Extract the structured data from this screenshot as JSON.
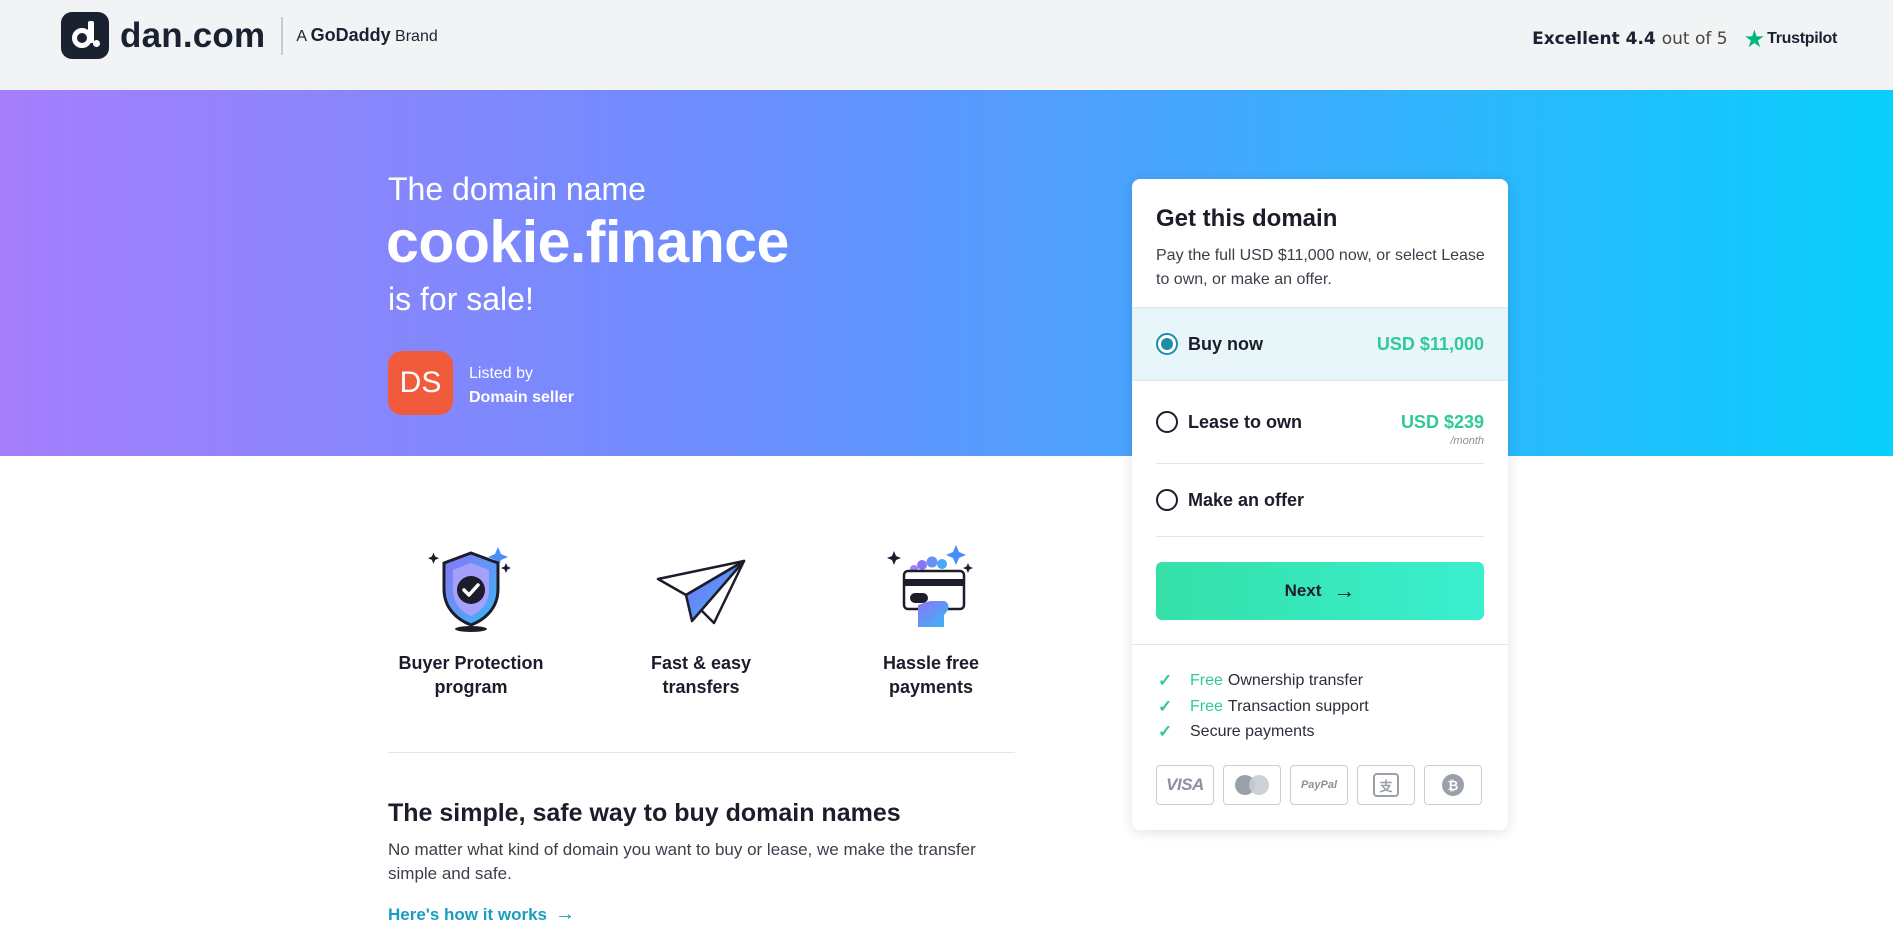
{
  "header": {
    "logo_text": "dan.com",
    "brand_prefix": "A",
    "brand_name": "GoDaddy",
    "brand_suffix": "Brand",
    "trust_rating_label": "Excellent 4.4",
    "trust_rating_scale": "out of 5",
    "trust_provider": "Trustpilot"
  },
  "hero": {
    "line1": "The domain name",
    "domain": "cookie.finance",
    "line2": "is for sale!",
    "avatar_initials": "DS",
    "listed_by_label": "Listed by",
    "seller_name": "Domain seller"
  },
  "features": [
    {
      "label_line1": "Buyer Protection",
      "label_line2": "program",
      "icon": "shield-check-icon"
    },
    {
      "label_line1": "Fast & easy",
      "label_line2": "transfers",
      "icon": "paper-plane-icon"
    },
    {
      "label_line1": "Hassle free",
      "label_line2": "payments",
      "icon": "card-payment-icon"
    }
  ],
  "info": {
    "title": "The simple, safe way to buy domain names",
    "description": "No matter what kind of domain you want to buy or lease, we make the transfer simple and safe.",
    "link_text": "Here's how it works"
  },
  "card": {
    "title": "Get this domain",
    "description": "Pay the full USD $11,000 now, or select Lease to own, or make an offer.",
    "options": [
      {
        "name": "Buy now",
        "price": "USD $11,000",
        "selected": true
      },
      {
        "name": "Lease to own",
        "price": "USD $239",
        "per": "/month",
        "selected": false
      },
      {
        "name": "Make an offer",
        "selected": false
      }
    ],
    "next_label": "Next",
    "perks": [
      {
        "free": "Free",
        "text": "Ownership transfer"
      },
      {
        "free": "Free",
        "text": "Transaction support"
      },
      {
        "free": "",
        "text": "Secure payments"
      }
    ],
    "payment_methods": {
      "visa": "VISA",
      "paypal": "PayPal",
      "bitcoin": "₿"
    }
  },
  "colors": {
    "accent_green": "#2fc99a",
    "link_blue": "#1a9dbf",
    "avatar": "#f15a3a",
    "hero_gradient_start": "#a57efc",
    "hero_gradient_end": "#08cffc"
  }
}
